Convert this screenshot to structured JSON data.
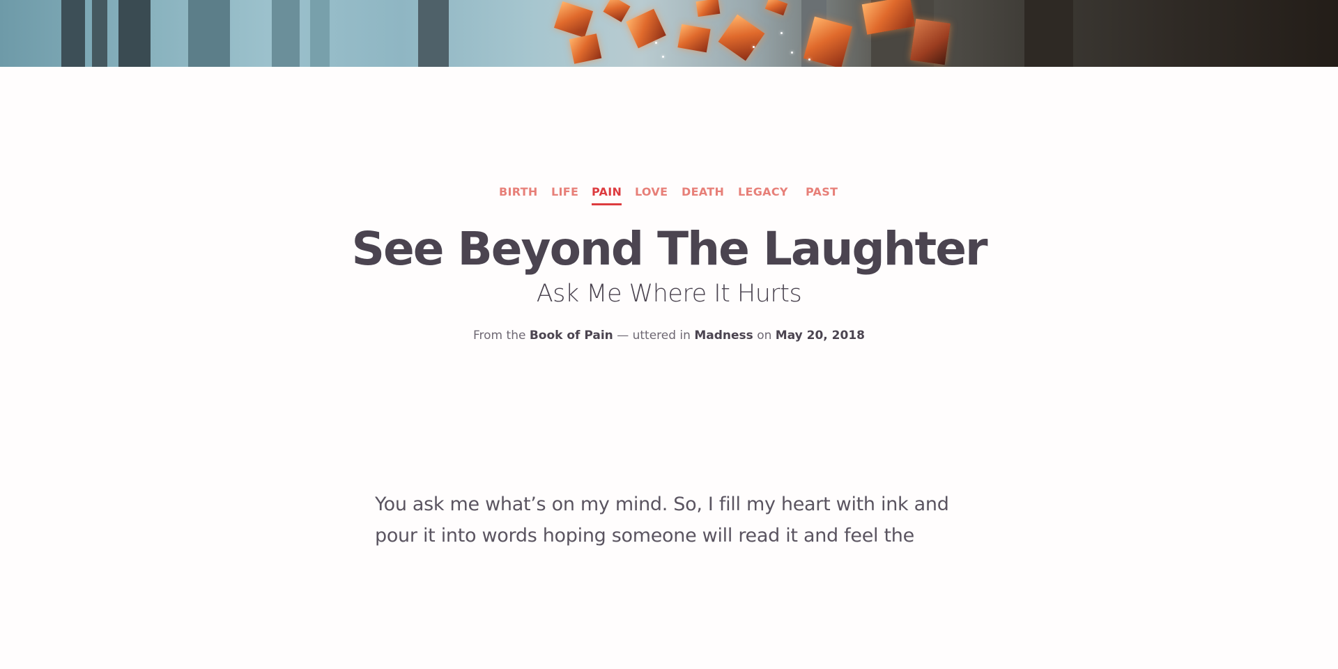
{
  "hero": {
    "image_name": "forest-floating-rocks-banner",
    "colors": {
      "sky": "#9cc1cc",
      "glow": "#e06a2c",
      "dark": "#231d18"
    }
  },
  "nav": {
    "tags": [
      {
        "label": "BIRTH",
        "active": false
      },
      {
        "label": "LIFE",
        "active": false
      },
      {
        "label": "PAIN",
        "active": true
      },
      {
        "label": "LOVE",
        "active": false
      },
      {
        "label": "DEATH",
        "active": false
      },
      {
        "label": "LEGACY",
        "active": false
      },
      {
        "label": "PAST",
        "active": false
      }
    ],
    "accent_color": "#dd3b3f",
    "tag_color": "#e77f78"
  },
  "post": {
    "title": "See Beyond The Laughter",
    "subtitle": "Ask Me Where It Hurts",
    "meta": {
      "prefix": "From the",
      "book": "Book of Pain",
      "separator": "— uttered in",
      "place": "Madness",
      "on": "on",
      "date": "May 20, 2018"
    },
    "body": "You ask me what’s on my mind. So, I fill my heart with ink and pour it into words hoping someone will read it and feel the"
  }
}
